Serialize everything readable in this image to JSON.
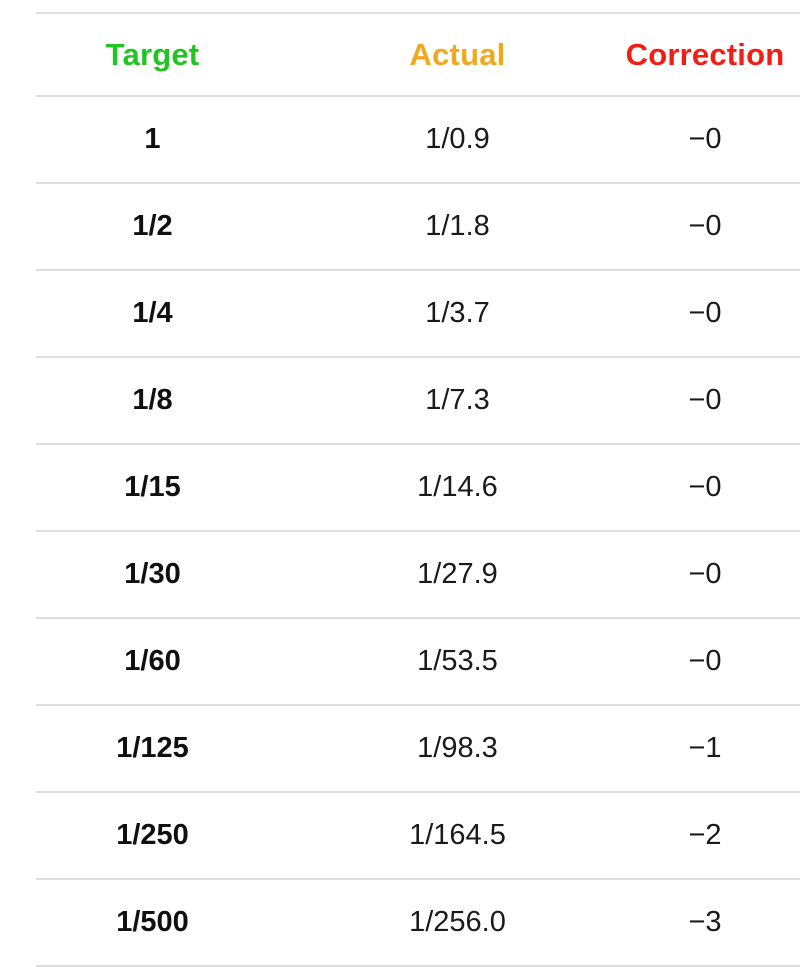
{
  "table": {
    "columns": [
      {
        "label": "Target",
        "color": "#21c521",
        "align": "center"
      },
      {
        "label": "Actual",
        "color": "#f0a81e",
        "align": "center"
      },
      {
        "label": "Correction",
        "color": "#f01e14",
        "align": "center"
      }
    ],
    "rows": [
      {
        "target": "1",
        "actual": "1/0.9",
        "correction": "−0"
      },
      {
        "target": "1/2",
        "actual": "1/1.8",
        "correction": "−0"
      },
      {
        "target": "1/4",
        "actual": "1/3.7",
        "correction": "−0"
      },
      {
        "target": "1/8",
        "actual": "1/7.3",
        "correction": "−0"
      },
      {
        "target": "1/15",
        "actual": "1/14.6",
        "correction": "−0"
      },
      {
        "target": "1/30",
        "actual": "1/27.9",
        "correction": "−0"
      },
      {
        "target": "1/60",
        "actual": "1/53.5",
        "correction": "−0"
      },
      {
        "target": "1/125",
        "actual": "1/98.3",
        "correction": "−1"
      },
      {
        "target": "1/250",
        "actual": "1/164.5",
        "correction": "−2"
      },
      {
        "target": "1/500",
        "actual": "1/256.0",
        "correction": "−3"
      }
    ]
  },
  "chart_data": {
    "type": "table",
    "title": "",
    "columns": [
      "Target",
      "Actual",
      "Correction"
    ],
    "rows": [
      [
        "1",
        "1/0.9",
        "−0"
      ],
      [
        "1/2",
        "1/1.8",
        "−0"
      ],
      [
        "1/4",
        "1/3.7",
        "−0"
      ],
      [
        "1/8",
        "1/7.3",
        "−0"
      ],
      [
        "1/15",
        "1/14.6",
        "−0"
      ],
      [
        "1/30",
        "1/27.9",
        "−0"
      ],
      [
        "1/60",
        "1/53.5",
        "−0"
      ],
      [
        "1/125",
        "1/98.3",
        "−1"
      ],
      [
        "1/250",
        "1/164.5",
        "−2"
      ],
      [
        "1/500",
        "1/256.0",
        "−3"
      ]
    ]
  },
  "style": {
    "divider_color": "#dcdcdc",
    "background": "#ffffff"
  }
}
